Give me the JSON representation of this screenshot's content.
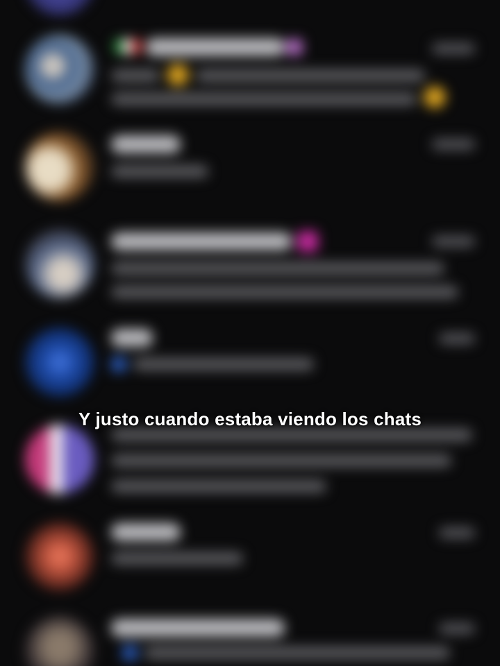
{
  "screen": {
    "title": "chat list (blurred)",
    "background_color": "#0b0b0c"
  },
  "caption": {
    "text": "Y justo cuando estaba viendo los chats",
    "color": "#ffffff"
  },
  "chats": [
    {
      "id": "chat-1",
      "badge_icon": "flag-icon",
      "emoji_icons": [
        "grinning-face-icon",
        "grinning-face-icon"
      ],
      "avatar_colors": [
        "#7a8fa8",
        "#3b5a86",
        "#c9c4be"
      ]
    },
    {
      "id": "chat-2",
      "avatar_colors": [
        "#e8dcc4",
        "#8a5a2a",
        "#3a2a1e"
      ]
    },
    {
      "id": "chat-3",
      "badge_icon": "heart-icon",
      "badge_color": "#c02a9a",
      "avatar_colors": [
        "#5b6b8c",
        "#d8cfc4",
        "#2e2e38"
      ]
    },
    {
      "id": "chat-4",
      "preview_icon": "check-icon",
      "avatar_colors": [
        "#1d4aa8",
        "#0f2b66"
      ]
    },
    {
      "id": "chat-5",
      "avatar_colors": [
        "#c43a7a",
        "#6a5cc0",
        "#e8e0ea"
      ]
    },
    {
      "id": "chat-6",
      "avatar_colors": [
        "#c0543e",
        "#4a1e18"
      ]
    },
    {
      "id": "chat-7",
      "preview_icon": "check-icon",
      "avatar_colors": [
        "#8a7a6a",
        "#3a3234"
      ]
    }
  ]
}
